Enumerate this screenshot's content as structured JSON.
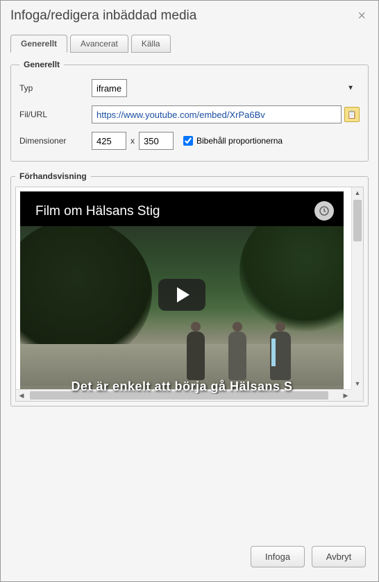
{
  "dialog": {
    "title": "Infoga/redigera inbäddad media",
    "close_symbol": "×"
  },
  "tabs": {
    "general": "Generellt",
    "advanced": "Avancerat",
    "source": "Källa",
    "active_index": 0
  },
  "general": {
    "legend": "Generellt",
    "type_label": "Typ",
    "type_value": "iframe",
    "url_label": "Fil/URL",
    "url_value": "https://www.youtube.com/embed/XrPa6Bv",
    "dimensions_label": "Dimensioner",
    "width": "425",
    "height": "350",
    "dimension_sep": "x",
    "constrain_checked": true,
    "constrain_label": "Bibehåll proportionerna"
  },
  "preview": {
    "legend": "Förhandsvisning",
    "video_title": "Film om Hälsans Stig",
    "caption": "Det är enkelt att börja gå Hälsans S"
  },
  "footer": {
    "insert": "Infoga",
    "cancel": "Avbryt"
  }
}
